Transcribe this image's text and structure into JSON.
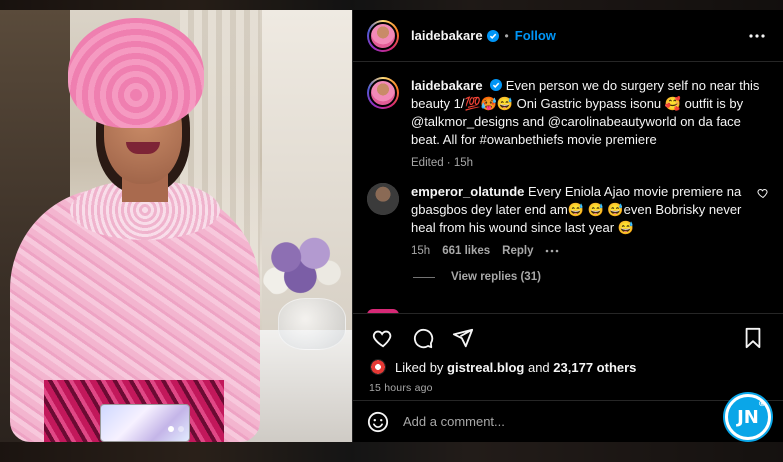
{
  "post": {
    "username": "laidebakare",
    "follow_label": "Follow",
    "caption_user": "laidebakare",
    "caption_text": "Even person we do surgery self no near this beauty 1/💯🥵😅 Oni Gastric bypass isonu 🥰 outfit is by @talkmor_designs and @carolinabeautyworld on da face beat. All for #owanbethiefs movie premiere",
    "caption_meta": "Edited · 15h"
  },
  "comments": [
    {
      "username": "emperor_olatunde",
      "text": "Every Eniola Ajao movie premiere na gbasgbos dey later end am😅 😅 😅even Bobrisky never heal from his wound since last year 😅",
      "age": "15h",
      "likes": "661 likes",
      "reply_label": "Reply",
      "view_replies": "View replies (31)"
    }
  ],
  "likes_line": {
    "prefix": "Liked by",
    "user": "gistreal.blog",
    "conj": "and",
    "others": "23,177 others"
  },
  "timestamp": "15 hours ago",
  "add_comment_placeholder": "Add a comment...",
  "watermark": "JN",
  "icons": [
    "more-icon",
    "verified-icon",
    "heart-icon",
    "comment-icon",
    "share-icon",
    "bookmark-icon",
    "emoji-icon"
  ],
  "colors": {
    "accent": "#0095f6",
    "panel_bg": "#000000",
    "muted": "#a8a8a8"
  }
}
